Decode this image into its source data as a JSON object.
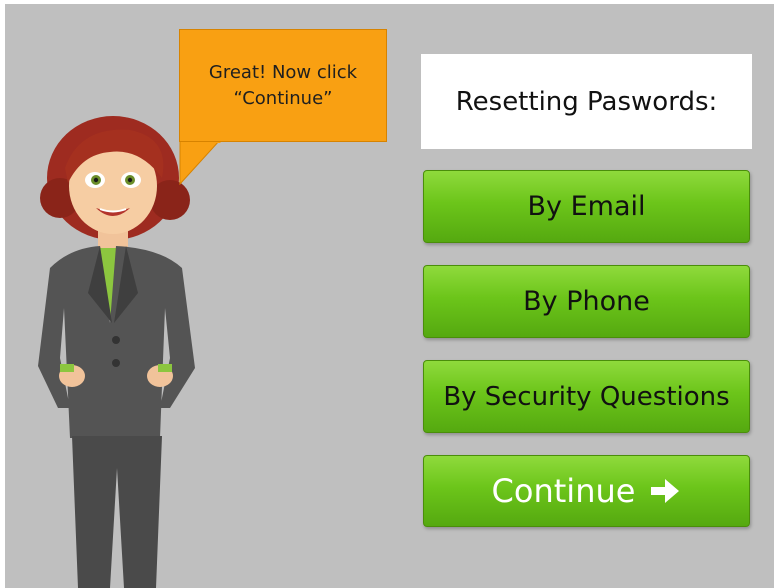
{
  "speech_bubble": {
    "line1": "Great! Now click",
    "line2": "“Continue”"
  },
  "title": "Resetting Paswords:",
  "options": {
    "email": "By Email",
    "phone": "By Phone",
    "security": "By Security Questions"
  },
  "continue_button": {
    "label": "Continue",
    "icon": "arrow-right-icon"
  },
  "colors": {
    "background": "#bfbfbf",
    "bubble": "#f9a012",
    "button_green": "#6cc51a"
  }
}
